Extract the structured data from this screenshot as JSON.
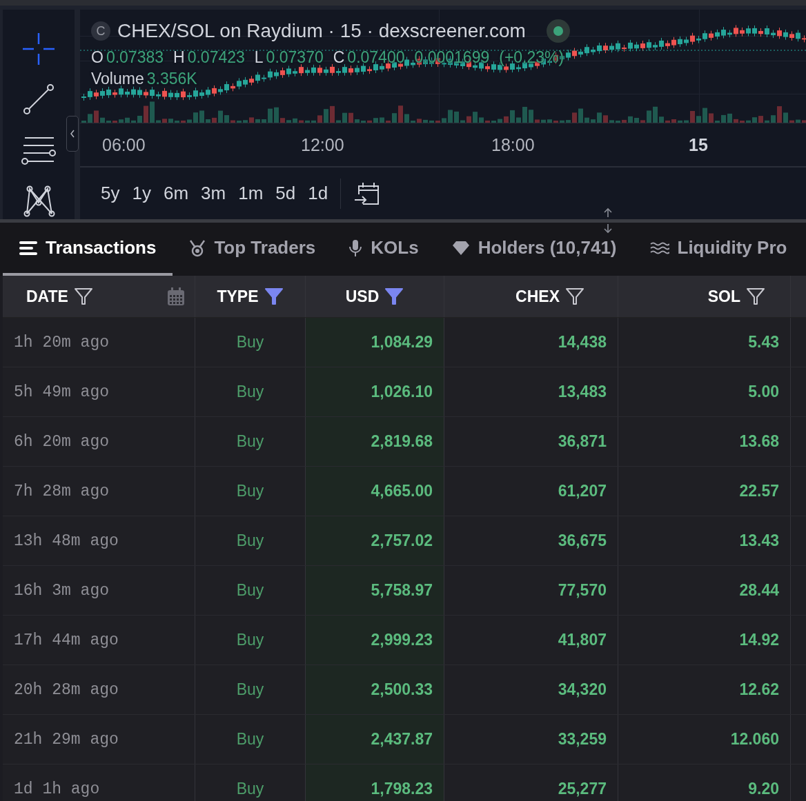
{
  "toolbar": {
    "tools": [
      {
        "kind": "crosshair",
        "selected": true
      },
      {
        "kind": "trendline",
        "selected": false
      },
      {
        "kind": "fib",
        "selected": false
      },
      {
        "kind": "pattern",
        "selected": false
      }
    ]
  },
  "chart": {
    "symbol_badge": "C",
    "title": "CHEX/SOL on Raydium · 15 · dexscreener.com",
    "live": true,
    "legend": [
      {
        "label": "O",
        "value": "0.07383"
      },
      {
        "label": "H",
        "value": "0.07423"
      },
      {
        "label": "L",
        "value": "0.07370"
      },
      {
        "label": "C",
        "value": "0.07400"
      }
    ],
    "change": "0.0001699",
    "change_pct": "(+0.23%)",
    "volume": {
      "label": "Volume",
      "value": "3.356K"
    },
    "time_labels": [
      {
        "text": "06:00",
        "bold": false
      },
      {
        "text": "12:00",
        "bold": false
      },
      {
        "text": "18:00",
        "bold": false
      },
      {
        "text": "15",
        "bold": true
      }
    ],
    "timeframes": [
      "5y",
      "1y",
      "6m",
      "3m",
      "1m",
      "5d",
      "1d"
    ]
  },
  "tabs": [
    {
      "label": "Transactions",
      "kind": "list",
      "selected": true
    },
    {
      "label": "Top Traders",
      "kind": "medal",
      "selected": false
    },
    {
      "label": "KOLs",
      "kind": "mic",
      "selected": false
    },
    {
      "label": "Holders (10,741)",
      "kind": "diamond",
      "selected": false
    },
    {
      "label": "Liquidity Pro",
      "kind": "waves",
      "selected": false
    }
  ],
  "table": {
    "columns": [
      {
        "label": "DATE",
        "filtered": false,
        "calendar": true
      },
      {
        "label": "TYPE",
        "filtered": true,
        "calendar": false
      },
      {
        "label": "USD",
        "filtered": true,
        "calendar": false
      },
      {
        "label": "CHEX",
        "filtered": false,
        "calendar": false
      },
      {
        "label": "SOL",
        "filtered": false,
        "calendar": false
      }
    ],
    "rows": [
      [
        "1h 20m ago",
        "Buy",
        "1,084.29",
        "14,438",
        "5.43"
      ],
      [
        "5h 49m ago",
        "Buy",
        "1,026.10",
        "13,483",
        "5.00"
      ],
      [
        "6h 20m ago",
        "Buy",
        "2,819.68",
        "36,871",
        "13.68"
      ],
      [
        "7h 28m ago",
        "Buy",
        "4,665.00",
        "61,207",
        "22.57"
      ],
      [
        "13h 48m ago",
        "Buy",
        "2,757.02",
        "36,675",
        "13.43"
      ],
      [
        "16h 3m ago",
        "Buy",
        "5,758.97",
        "77,570",
        "28.44"
      ],
      [
        "17h 44m ago",
        "Buy",
        "2,999.23",
        "41,807",
        "14.92"
      ],
      [
        "20h 28m ago",
        "Buy",
        "2,500.33",
        "34,320",
        "12.62"
      ],
      [
        "21h 29m ago",
        "Buy",
        "2,437.87",
        "33,259",
        "12.060"
      ],
      [
        "1d 1h ago",
        "Buy",
        "1,798.23",
        "25,277",
        "9.20"
      ]
    ]
  }
}
